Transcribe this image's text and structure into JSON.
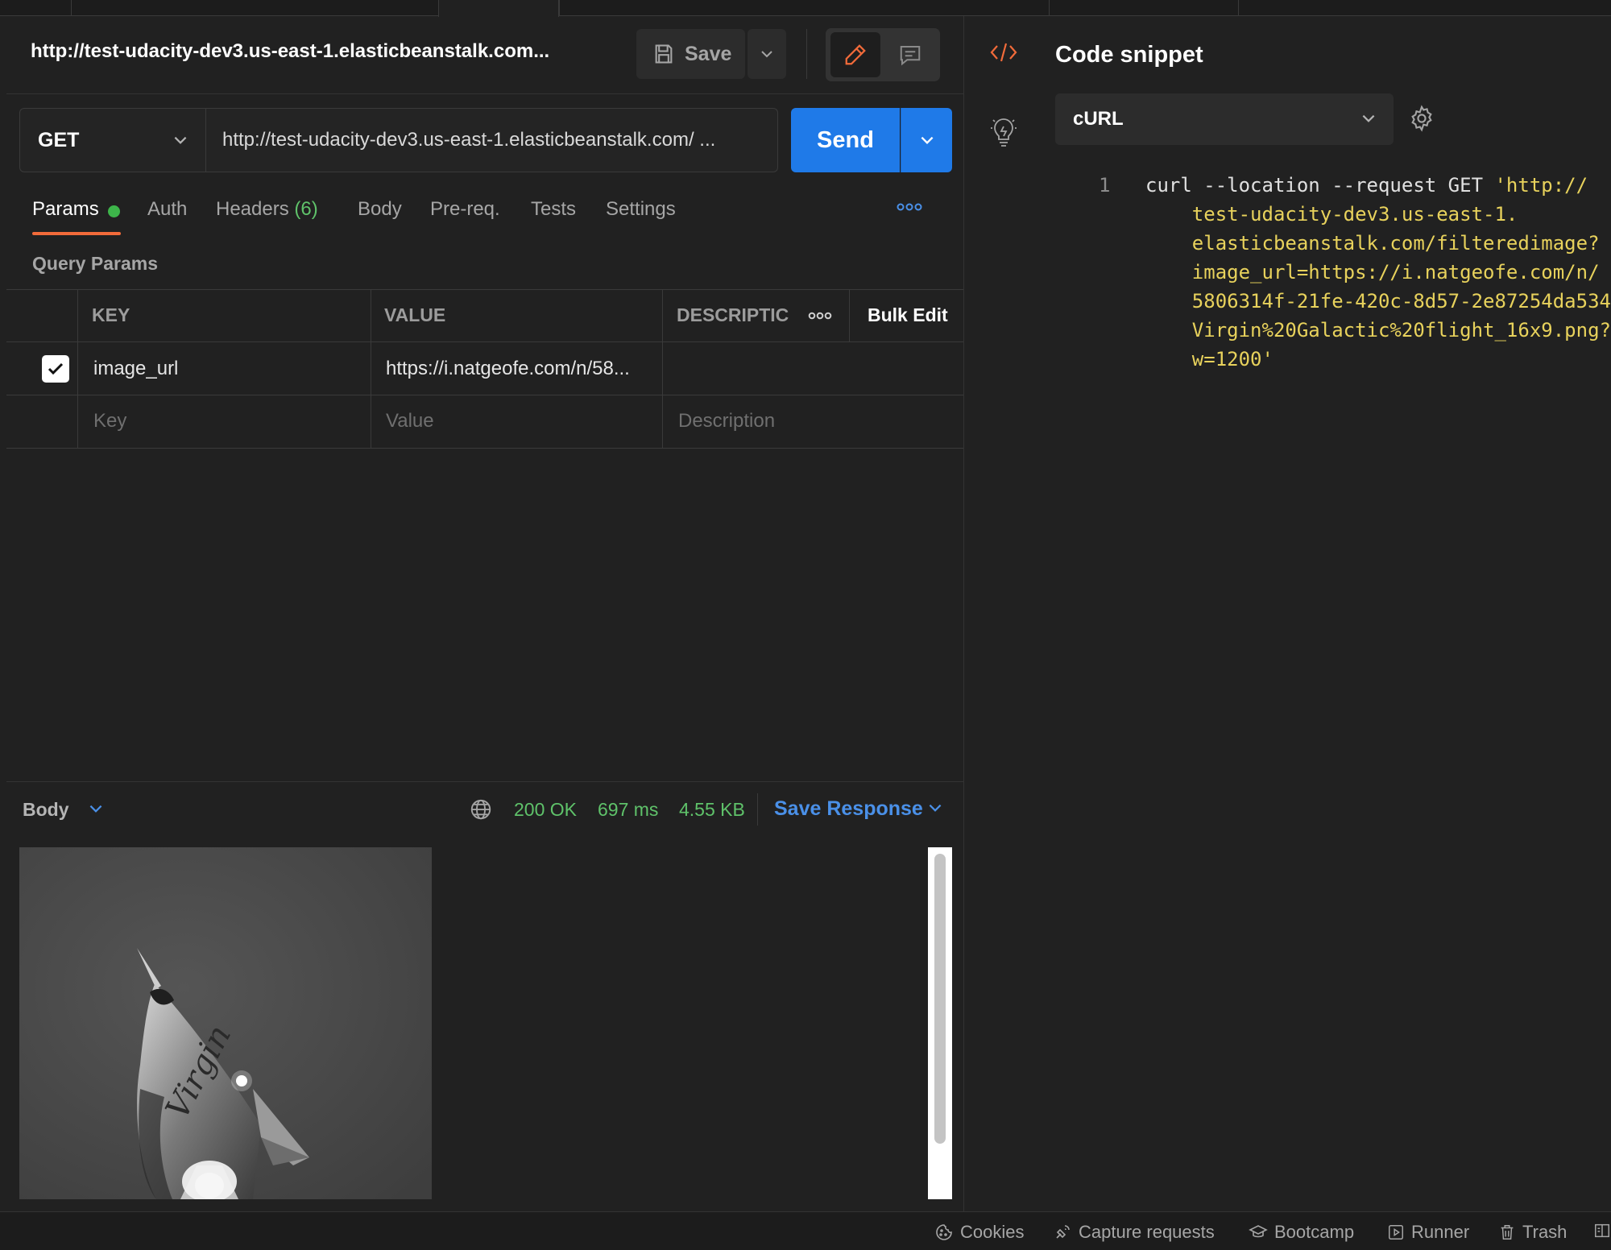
{
  "request": {
    "title": "http://test-udacity-dev3.us-east-1.elasticbeanstalk.com...",
    "save_label": "Save",
    "method": "GET",
    "url": "http://test-udacity-dev3.us-east-1.elasticbeanstalk.com/ ...",
    "send_label": "Send"
  },
  "tabs": {
    "params": "Params",
    "auth": "Auth",
    "headers": "Headers",
    "headers_count": "(6)",
    "body": "Body",
    "prereq": "Pre-req.",
    "tests": "Tests",
    "settings": "Settings"
  },
  "query_params": {
    "label": "Query Params",
    "headers": {
      "key": "KEY",
      "value": "VALUE",
      "description": "DESCRIPTIC",
      "bulk_edit": "Bulk Edit"
    },
    "rows": [
      {
        "checked": true,
        "key": "image_url",
        "value": "https://i.natgeofe.com/n/58...",
        "description": ""
      }
    ],
    "placeholders": {
      "key": "Key",
      "value": "Value",
      "description": "Description"
    }
  },
  "response": {
    "body_label": "Body",
    "status": "200 OK",
    "time": "697 ms",
    "size": "4.55 KB",
    "save_response": "Save Response",
    "image_text": "Virgin"
  },
  "snippet": {
    "title": "Code snippet",
    "language": "cURL",
    "line_number": "1",
    "lines": [
      {
        "plain": "curl --location --request GET ",
        "str": "'http://"
      },
      {
        "plain": "",
        "str": "    test-udacity-dev3.us-east-1."
      },
      {
        "plain": "",
        "str": "    elasticbeanstalk.com/filteredimage?"
      },
      {
        "plain": "",
        "str": "    image_url=https://i.natgeofe.com/n/"
      },
      {
        "plain": "",
        "str": "    5806314f-21fe-420c-8d57-2e87254da534"
      },
      {
        "plain": "",
        "str": "    Virgin%20Galactic%20flight_16x9.png?"
      },
      {
        "plain": "",
        "str": "    w=1200'"
      }
    ]
  },
  "status_bar": {
    "cookies": "Cookies",
    "capture": "Capture requests",
    "bootcamp": "Bootcamp",
    "runner": "Runner",
    "trash": "Trash"
  },
  "colors": {
    "accent": "#1f7ae8",
    "tab_underline": "#f26b3a",
    "status_ok": "#5fc26a",
    "string": "#e8d25c"
  }
}
